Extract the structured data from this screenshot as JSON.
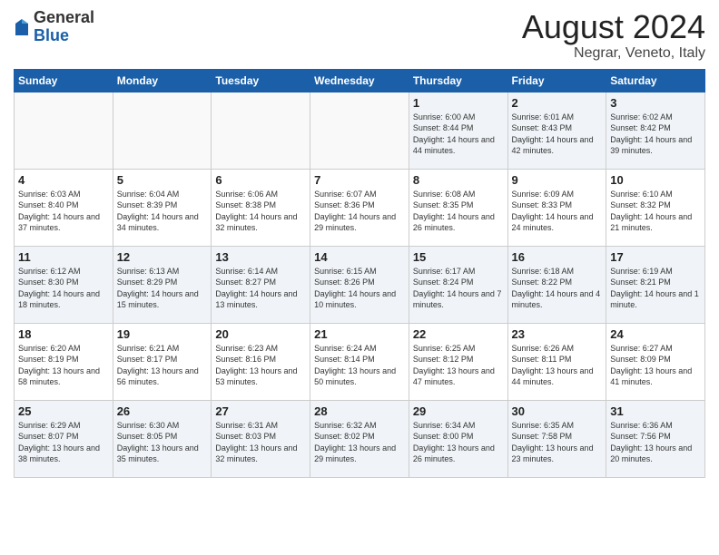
{
  "header": {
    "logo_general": "General",
    "logo_blue": "Blue",
    "month_title": "August 2024",
    "location": "Negrar, Veneto, Italy"
  },
  "days_of_week": [
    "Sunday",
    "Monday",
    "Tuesday",
    "Wednesday",
    "Thursday",
    "Friday",
    "Saturday"
  ],
  "weeks": [
    [
      {
        "day": "",
        "info": ""
      },
      {
        "day": "",
        "info": ""
      },
      {
        "day": "",
        "info": ""
      },
      {
        "day": "",
        "info": ""
      },
      {
        "day": "1",
        "info": "Sunrise: 6:00 AM\nSunset: 8:44 PM\nDaylight: 14 hours and 44 minutes."
      },
      {
        "day": "2",
        "info": "Sunrise: 6:01 AM\nSunset: 8:43 PM\nDaylight: 14 hours and 42 minutes."
      },
      {
        "day": "3",
        "info": "Sunrise: 6:02 AM\nSunset: 8:42 PM\nDaylight: 14 hours and 39 minutes."
      }
    ],
    [
      {
        "day": "4",
        "info": "Sunrise: 6:03 AM\nSunset: 8:40 PM\nDaylight: 14 hours and 37 minutes."
      },
      {
        "day": "5",
        "info": "Sunrise: 6:04 AM\nSunset: 8:39 PM\nDaylight: 14 hours and 34 minutes."
      },
      {
        "day": "6",
        "info": "Sunrise: 6:06 AM\nSunset: 8:38 PM\nDaylight: 14 hours and 32 minutes."
      },
      {
        "day": "7",
        "info": "Sunrise: 6:07 AM\nSunset: 8:36 PM\nDaylight: 14 hours and 29 minutes."
      },
      {
        "day": "8",
        "info": "Sunrise: 6:08 AM\nSunset: 8:35 PM\nDaylight: 14 hours and 26 minutes."
      },
      {
        "day": "9",
        "info": "Sunrise: 6:09 AM\nSunset: 8:33 PM\nDaylight: 14 hours and 24 minutes."
      },
      {
        "day": "10",
        "info": "Sunrise: 6:10 AM\nSunset: 8:32 PM\nDaylight: 14 hours and 21 minutes."
      }
    ],
    [
      {
        "day": "11",
        "info": "Sunrise: 6:12 AM\nSunset: 8:30 PM\nDaylight: 14 hours and 18 minutes."
      },
      {
        "day": "12",
        "info": "Sunrise: 6:13 AM\nSunset: 8:29 PM\nDaylight: 14 hours and 15 minutes."
      },
      {
        "day": "13",
        "info": "Sunrise: 6:14 AM\nSunset: 8:27 PM\nDaylight: 14 hours and 13 minutes."
      },
      {
        "day": "14",
        "info": "Sunrise: 6:15 AM\nSunset: 8:26 PM\nDaylight: 14 hours and 10 minutes."
      },
      {
        "day": "15",
        "info": "Sunrise: 6:17 AM\nSunset: 8:24 PM\nDaylight: 14 hours and 7 minutes."
      },
      {
        "day": "16",
        "info": "Sunrise: 6:18 AM\nSunset: 8:22 PM\nDaylight: 14 hours and 4 minutes."
      },
      {
        "day": "17",
        "info": "Sunrise: 6:19 AM\nSunset: 8:21 PM\nDaylight: 14 hours and 1 minute."
      }
    ],
    [
      {
        "day": "18",
        "info": "Sunrise: 6:20 AM\nSunset: 8:19 PM\nDaylight: 13 hours and 58 minutes."
      },
      {
        "day": "19",
        "info": "Sunrise: 6:21 AM\nSunset: 8:17 PM\nDaylight: 13 hours and 56 minutes."
      },
      {
        "day": "20",
        "info": "Sunrise: 6:23 AM\nSunset: 8:16 PM\nDaylight: 13 hours and 53 minutes."
      },
      {
        "day": "21",
        "info": "Sunrise: 6:24 AM\nSunset: 8:14 PM\nDaylight: 13 hours and 50 minutes."
      },
      {
        "day": "22",
        "info": "Sunrise: 6:25 AM\nSunset: 8:12 PM\nDaylight: 13 hours and 47 minutes."
      },
      {
        "day": "23",
        "info": "Sunrise: 6:26 AM\nSunset: 8:11 PM\nDaylight: 13 hours and 44 minutes."
      },
      {
        "day": "24",
        "info": "Sunrise: 6:27 AM\nSunset: 8:09 PM\nDaylight: 13 hours and 41 minutes."
      }
    ],
    [
      {
        "day": "25",
        "info": "Sunrise: 6:29 AM\nSunset: 8:07 PM\nDaylight: 13 hours and 38 minutes."
      },
      {
        "day": "26",
        "info": "Sunrise: 6:30 AM\nSunset: 8:05 PM\nDaylight: 13 hours and 35 minutes."
      },
      {
        "day": "27",
        "info": "Sunrise: 6:31 AM\nSunset: 8:03 PM\nDaylight: 13 hours and 32 minutes."
      },
      {
        "day": "28",
        "info": "Sunrise: 6:32 AM\nSunset: 8:02 PM\nDaylight: 13 hours and 29 minutes."
      },
      {
        "day": "29",
        "info": "Sunrise: 6:34 AM\nSunset: 8:00 PM\nDaylight: 13 hours and 26 minutes."
      },
      {
        "day": "30",
        "info": "Sunrise: 6:35 AM\nSunset: 7:58 PM\nDaylight: 13 hours and 23 minutes."
      },
      {
        "day": "31",
        "info": "Sunrise: 6:36 AM\nSunset: 7:56 PM\nDaylight: 13 hours and 20 minutes."
      }
    ]
  ]
}
